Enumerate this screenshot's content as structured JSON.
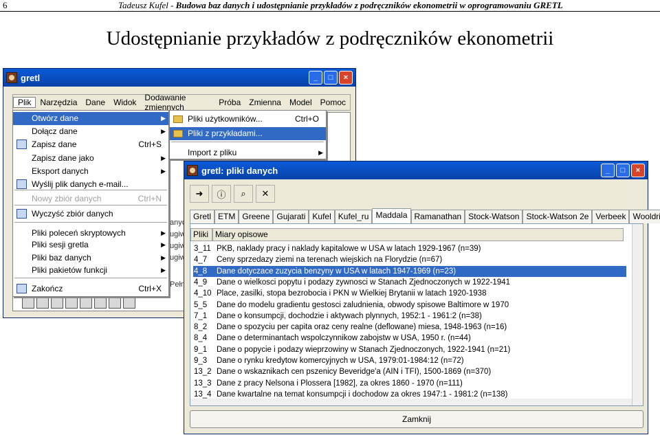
{
  "page": {
    "number": "6",
    "running_author": "Tadeusz Kufel  - ",
    "running_title": "Budowa baz danych i udostępnianie przykładów z podręczników ekonometrii w oprogramowaniu GRETL",
    "title": "Udostępnianie przykładów z podręczników ekonometrii"
  },
  "main_window": {
    "title": "gretl",
    "menu": [
      "Plik",
      "Narzędzia",
      "Dane",
      "Widok",
      "Dodawanie zmiennych",
      "Próba",
      "Zmienna",
      "Model",
      "Pomoc"
    ],
    "behind_texts": [
      "anyc",
      "ugiw",
      "ugiw",
      "ugiw",
      "Pełn"
    ]
  },
  "plik_menu": {
    "items": [
      {
        "label": "Otwórz dane",
        "shortcut": "",
        "submenu": true,
        "icon": ""
      },
      {
        "label": "Dołącz dane",
        "shortcut": "",
        "submenu": true,
        "icon": ""
      },
      {
        "label": "Zapisz dane",
        "shortcut": "Ctrl+S",
        "submenu": false,
        "icon": "floppy-icon"
      },
      {
        "label": "Zapisz dane jako",
        "shortcut": "",
        "submenu": true,
        "icon": ""
      },
      {
        "label": "Eksport danych",
        "shortcut": "",
        "submenu": true,
        "icon": ""
      },
      {
        "label": "Wyślij plik danych e-mail...",
        "shortcut": "",
        "submenu": false,
        "icon": "envelope-icon"
      },
      {
        "label": "Nowy zbiór danych",
        "shortcut": "Ctrl+N",
        "submenu": false,
        "icon": ""
      },
      {
        "label": "Wyczyść zbiór danych",
        "shortcut": "",
        "submenu": false,
        "icon": "broom-icon"
      },
      {
        "label": "Pliki poleceń skryptowych",
        "shortcut": "",
        "submenu": true,
        "icon": ""
      },
      {
        "label": "Pliki sesji gretla",
        "shortcut": "",
        "submenu": true,
        "icon": ""
      },
      {
        "label": "Pliki baz danych",
        "shortcut": "",
        "submenu": true,
        "icon": ""
      },
      {
        "label": "Pliki pakietów funkcji",
        "shortcut": "",
        "submenu": true,
        "icon": ""
      },
      {
        "label": "Zakończ",
        "shortcut": "Ctrl+X",
        "submenu": false,
        "icon": "exit-icon"
      }
    ]
  },
  "submenu": {
    "items": [
      {
        "label": "Pliki użytkowników...",
        "shortcut": "Ctrl+O"
      },
      {
        "label": "Pliki z przykładami...",
        "shortcut": ""
      },
      {
        "label": "Import z pliku",
        "shortcut": ""
      }
    ]
  },
  "dialog": {
    "title": "gretl: pliki danych",
    "tabs": [
      "Gretl",
      "ETM",
      "Greene",
      "Gujarati",
      "Kufel",
      "Kufel_ru",
      "Maddala",
      "Ramanathan",
      "Stock-Watson",
      "Stock-Watson 2e",
      "Verbeek",
      "Wooldridge"
    ],
    "active_tab": "Maddala",
    "columns": [
      "Pliki",
      "Miary opisowe"
    ],
    "rows": [
      {
        "file": "3_11",
        "desc": "PKB, naklady pracy i naklady kapitalowe w USA w latach 1929-1967 (n=39)"
      },
      {
        "file": "4_7",
        "desc": "Ceny sprzedazy ziemi na terenach wiejskich na Florydzie (n=67)"
      },
      {
        "file": "4_8",
        "desc": "Dane dotyczace zuzycia benzyny w USA w latach 1947-1969 (n=23)"
      },
      {
        "file": "4_9",
        "desc": "Dane o wielkosci popytu i podazy zywnosci w Stanach Zjednoczonych w 1922-1941"
      },
      {
        "file": "4_10",
        "desc": "Place, zasilki, stopa bezrobocia i PKN w Wielkiej Brytanii w latach 1920-1938"
      },
      {
        "file": "5_5",
        "desc": "Dane do modelu gradientu gestosci zaludnienia, obwody spisowe Baltimore w 1970"
      },
      {
        "file": "7_1",
        "desc": "Dane o konsumpcji, dochodzie i aktywach plynnych, 1952:1 - 1961:2 (n=38)"
      },
      {
        "file": "8_2",
        "desc": "Dane o spozyciu per capita oraz ceny realne (deflowane) miesa, 1948-1963 (n=16)"
      },
      {
        "file": "8_4",
        "desc": "Dane o determinantach wspolczynnikow zabojstw w USA, 1950 r. (n=44)"
      },
      {
        "file": "9_1",
        "desc": "Dane o popycie i podazy wieprzowiny w Stanach Zjednoczonych, 1922-1941 (n=21)"
      },
      {
        "file": "9_3",
        "desc": "Dane o rynku kredytow komercyjnych w USA, 1979:01-1984:12 (n=72)"
      },
      {
        "file": "13_2",
        "desc": "Dane o wskaznikach cen pszenicy Beveridge'a (AIN i TFI), 1500-1869 (n=370)"
      },
      {
        "file": "13_3",
        "desc": "Dane z pracy Nelsona i Plossera [1982], za okres 1860 - 1970 (n=111)"
      },
      {
        "file": "13_4",
        "desc": "Dane kwartalne na temat konsumpcji i dochodow za okres 1947:1 - 1981:2 (n=138)"
      }
    ],
    "selected_file": "4_8",
    "close_label": "Zamknij"
  }
}
